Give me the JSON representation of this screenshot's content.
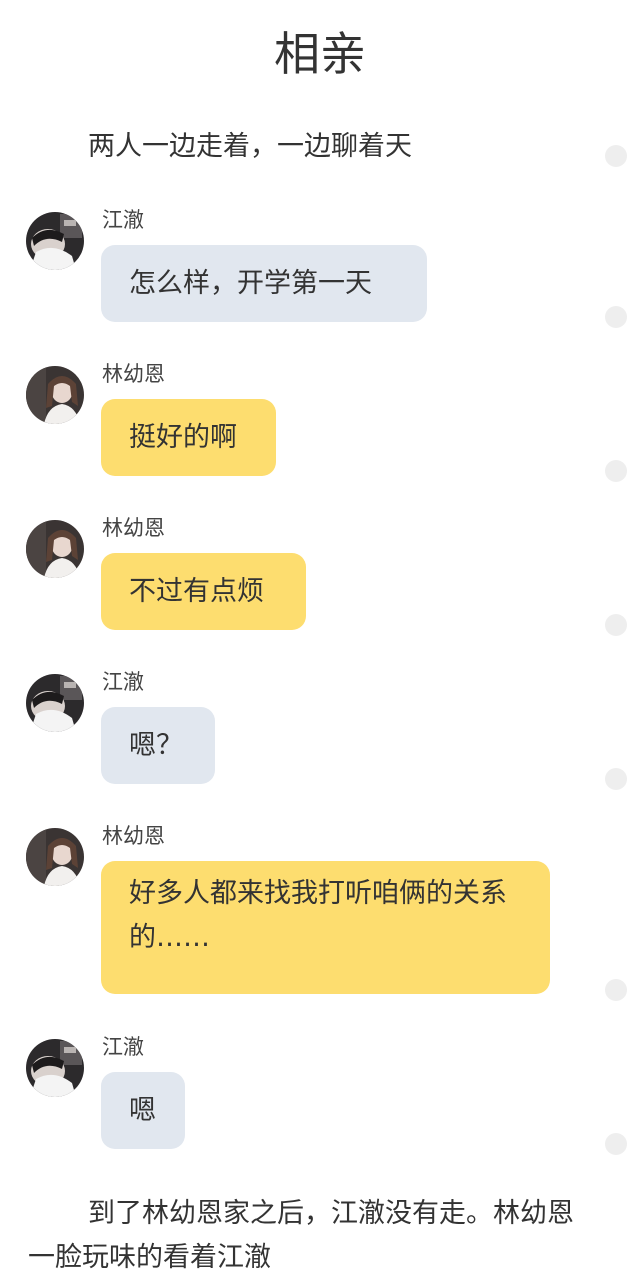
{
  "title": "相亲",
  "narration_top": "两人一边走着，一边聊着天",
  "messages": [
    {
      "sender": "江澈",
      "text": "怎么样，开学第一天",
      "avatar": "jiangche-avatar",
      "bubble_color": "#e1e7ef"
    },
    {
      "sender": "林幼恩",
      "text": "挺好的啊",
      "avatar": "linyouen-avatar",
      "bubble_color": "#fddd6f"
    },
    {
      "sender": "林幼恩",
      "text": "不过有点烦",
      "avatar": "linyouen-avatar",
      "bubble_color": "#fddd6f"
    },
    {
      "sender": "江澈",
      "text": "嗯？",
      "avatar": "jiangche-avatar",
      "bubble_color": "#e1e7ef"
    },
    {
      "sender": "林幼恩",
      "text": "好多人都来找我打听咱俩的关系的……",
      "avatar": "linyouen-avatar",
      "bubble_color": "#fddd6f"
    },
    {
      "sender": "江澈",
      "text": "嗯",
      "avatar": "jiangche-avatar",
      "bubble_color": "#e1e7ef"
    }
  ],
  "narration_bottom": "到了林幼恩家之后，江澈没有走。林幼恩一脸玩味的看着江澈",
  "colors": {
    "male_bubble": "#e1e7ef",
    "female_bubble": "#fddd6f",
    "text": "#333333",
    "side_dot": "#eeeeee"
  }
}
